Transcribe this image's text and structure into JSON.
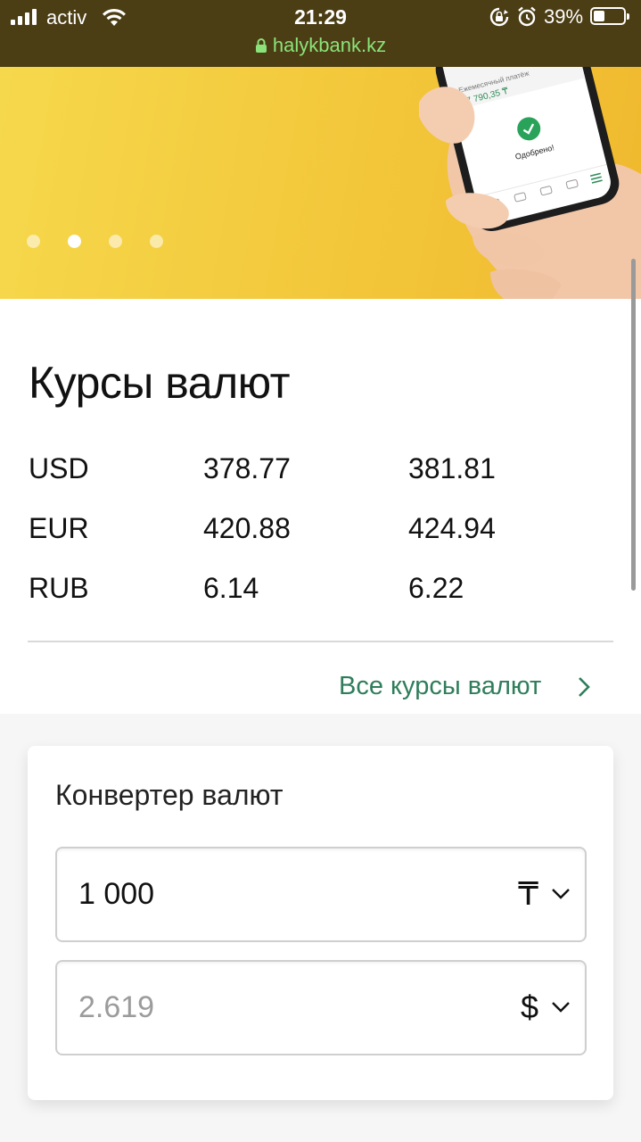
{
  "status_bar": {
    "carrier": "activ",
    "time": "21:29",
    "battery_percent": "39%",
    "battery_level": 0.39,
    "url": "halykbank.kz"
  },
  "banner": {
    "phone_amount": "27 790,35 ₸",
    "phone_status": "Одобрено!",
    "slides_total": 4,
    "active_slide": 2
  },
  "rates": {
    "title": "Курсы валют",
    "rows": [
      {
        "currency": "USD",
        "buy": "378.77",
        "sell": "381.81"
      },
      {
        "currency": "EUR",
        "buy": "420.88",
        "sell": "424.94"
      },
      {
        "currency": "RUB",
        "buy": "6.14",
        "sell": "6.22"
      }
    ],
    "all_rates_link": "Все курсы валют"
  },
  "converter": {
    "title": "Конвертер валют",
    "from": {
      "value": "1 000",
      "currency_symbol": "₸"
    },
    "to": {
      "placeholder": "2.619",
      "currency_symbol": "$"
    }
  },
  "colors": {
    "status_bar_bg": "#4b3d14",
    "url_green": "#8be37a",
    "banner_yellow": "#f3c73a",
    "link_green": "#2f7d5b"
  }
}
